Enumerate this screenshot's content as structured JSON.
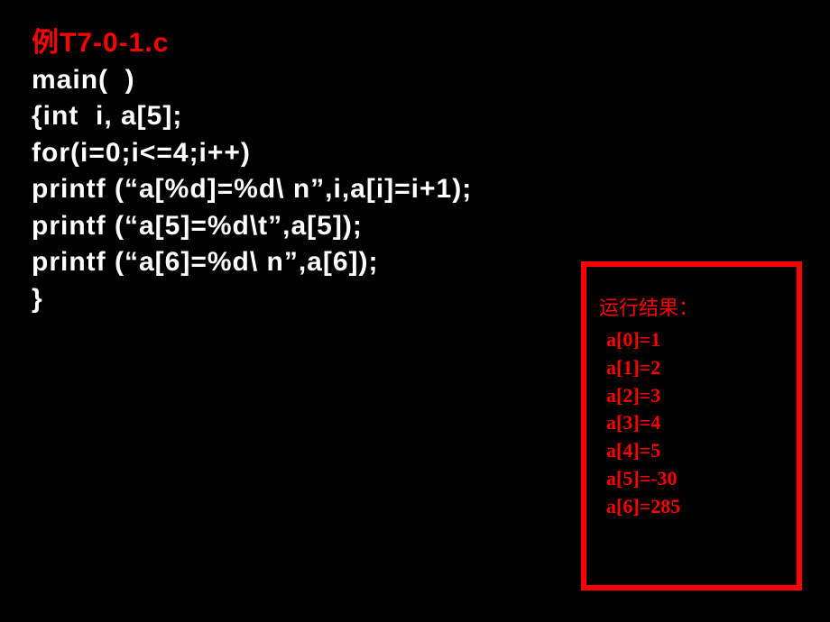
{
  "code": {
    "title": "例T7-0-1.c",
    "lines": [
      "main(  )",
      "{int  i, a[5];",
      "for(i=0;i<=4;i++)",
      "printf (“a[%d]=%d\\ n”,i,a[i]=i+1);",
      "printf (“a[5]=%d\\t”,a[5]);",
      "printf (“a[6]=%d\\ n”,a[6]);",
      "}"
    ]
  },
  "result": {
    "title": "运行结果：",
    "lines": [
      "a[0]=1",
      "a[1]=2",
      "a[2]=3",
      "a[3]=4",
      "a[4]=5",
      "a[5]=-30",
      "a[6]=285"
    ]
  }
}
